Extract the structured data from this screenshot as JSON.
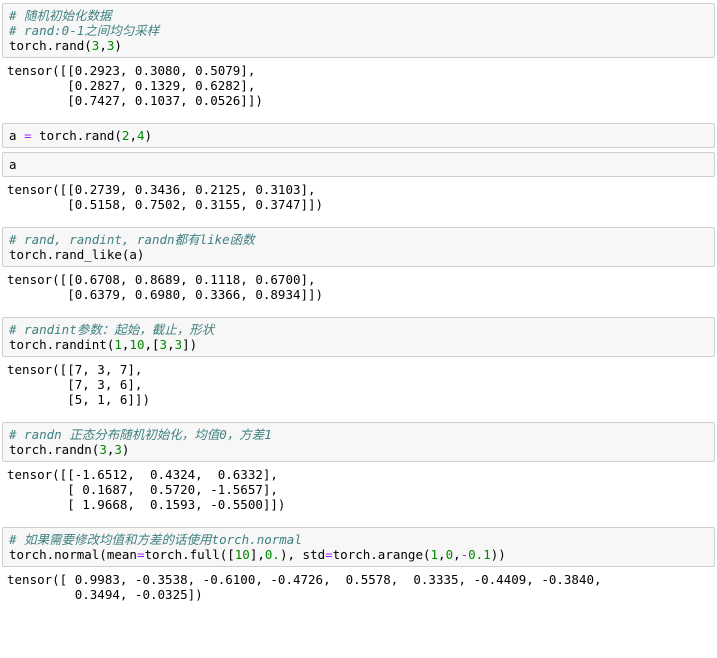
{
  "colors": {
    "comment": "#408080",
    "number": "#008800",
    "operator": "#aa22ff",
    "input_background": "#f7f7f7",
    "input_border": "#cfcfcf"
  },
  "cells": [
    {
      "input": [
        [
          {
            "t": "# 随机初始化数据",
            "c": "comment"
          }
        ],
        [
          {
            "t": "# rand:0-1之间均匀采样",
            "c": "comment"
          }
        ],
        [
          {
            "t": "torch.rand(",
            "c": "plain"
          },
          {
            "t": "3",
            "c": "number"
          },
          {
            "t": ",",
            "c": "plain"
          },
          {
            "t": "3",
            "c": "number"
          },
          {
            "t": ")",
            "c": "plain"
          }
        ]
      ],
      "output": [
        "tensor([[0.2923, 0.3080, 0.5079],",
        "        [0.2827, 0.1329, 0.6282],",
        "        [0.7427, 0.1037, 0.0526]])"
      ]
    },
    {
      "input": [
        [
          {
            "t": "a ",
            "c": "plain"
          },
          {
            "t": "=",
            "c": "operator"
          },
          {
            "t": " torch.rand(",
            "c": "plain"
          },
          {
            "t": "2",
            "c": "number"
          },
          {
            "t": ",",
            "c": "plain"
          },
          {
            "t": "4",
            "c": "number"
          },
          {
            "t": ")",
            "c": "plain"
          }
        ]
      ],
      "output": []
    },
    {
      "input": [
        [
          {
            "t": "a",
            "c": "plain"
          }
        ]
      ],
      "output": [
        "tensor([[0.2739, 0.3436, 0.2125, 0.3103],",
        "        [0.5158, 0.7502, 0.3155, 0.3747]])"
      ]
    },
    {
      "input": [
        [
          {
            "t": "# rand, randint, randn都有like函数",
            "c": "comment"
          }
        ],
        [
          {
            "t": "torch.rand_like(a)",
            "c": "plain"
          }
        ]
      ],
      "output": [
        "tensor([[0.6708, 0.8689, 0.1118, 0.6700],",
        "        [0.6379, 0.6980, 0.3366, 0.8934]])"
      ]
    },
    {
      "input": [
        [
          {
            "t": "# randint参数：起始，截止，形状",
            "c": "comment"
          }
        ],
        [
          {
            "t": "torch.randint(",
            "c": "plain"
          },
          {
            "t": "1",
            "c": "number"
          },
          {
            "t": ",",
            "c": "plain"
          },
          {
            "t": "10",
            "c": "number"
          },
          {
            "t": ",[",
            "c": "plain"
          },
          {
            "t": "3",
            "c": "number"
          },
          {
            "t": ",",
            "c": "plain"
          },
          {
            "t": "3",
            "c": "number"
          },
          {
            "t": "])",
            "c": "plain"
          }
        ]
      ],
      "output": [
        "tensor([[7, 3, 7],",
        "        [7, 3, 6],",
        "        [5, 1, 6]])"
      ]
    },
    {
      "input": [
        [
          {
            "t": "# randn 正态分布随机初始化，均值0，方差1",
            "c": "comment"
          }
        ],
        [
          {
            "t": "torch.randn(",
            "c": "plain"
          },
          {
            "t": "3",
            "c": "number"
          },
          {
            "t": ",",
            "c": "plain"
          },
          {
            "t": "3",
            "c": "number"
          },
          {
            "t": ")",
            "c": "plain"
          }
        ]
      ],
      "output": [
        "tensor([[-1.6512,  0.4324,  0.6332],",
        "        [ 0.1687,  0.5720, -1.5657],",
        "        [ 1.9668,  0.1593, -0.5500]])"
      ]
    },
    {
      "input": [
        [
          {
            "t": "# 如果需要修改均值和方差的话使用torch.normal",
            "c": "comment"
          }
        ],
        [
          {
            "t": "torch.normal(mean",
            "c": "plain"
          },
          {
            "t": "=",
            "c": "operator"
          },
          {
            "t": "torch.full([",
            "c": "plain"
          },
          {
            "t": "10",
            "c": "number"
          },
          {
            "t": "],",
            "c": "plain"
          },
          {
            "t": "0.",
            "c": "number"
          },
          {
            "t": "), std",
            "c": "plain"
          },
          {
            "t": "=",
            "c": "operator"
          },
          {
            "t": "torch.arange(",
            "c": "plain"
          },
          {
            "t": "1",
            "c": "number"
          },
          {
            "t": ",",
            "c": "plain"
          },
          {
            "t": "0",
            "c": "number"
          },
          {
            "t": ",",
            "c": "plain"
          },
          {
            "t": "-",
            "c": "operator"
          },
          {
            "t": "0.1",
            "c": "number"
          },
          {
            "t": "))",
            "c": "plain"
          }
        ]
      ],
      "output": [
        "tensor([ 0.9983, -0.3538, -0.6100, -0.4726,  0.5578,  0.3335, -0.4409, -0.3840,",
        "         0.3494, -0.0325])"
      ]
    }
  ]
}
